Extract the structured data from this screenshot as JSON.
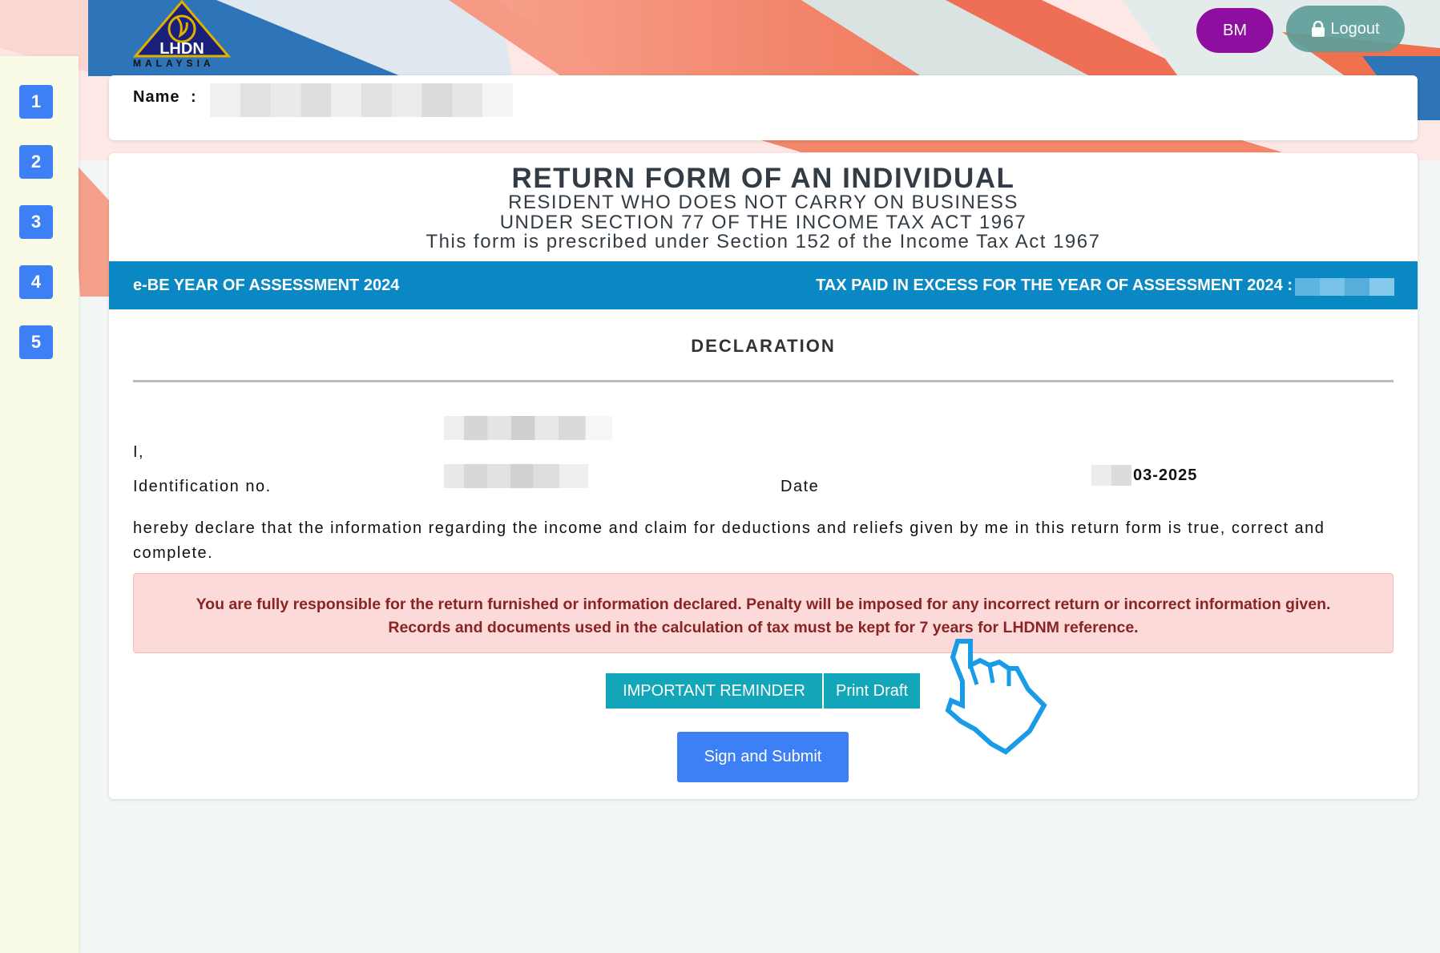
{
  "header": {
    "logo_text": "LHDN",
    "logo_subtext": "MALAYSIA",
    "bm_label": "BM",
    "logout_label": "Logout"
  },
  "sidebar": {
    "steps": [
      "1",
      "2",
      "3",
      "4",
      "5"
    ]
  },
  "name_card": {
    "label": "Name",
    "colon": ":"
  },
  "form": {
    "title": "RETURN FORM OF AN INDIVIDUAL",
    "subtitle_1": "RESIDENT WHO DOES NOT CARRY ON BUSINESS",
    "subtitle_2": "UNDER SECTION 77 OF THE INCOME TAX ACT 1967",
    "subtitle_3": "This form is prescribed under Section 152 of the Income Tax Act 1967",
    "bar_left": "e-BE YEAR OF ASSESSMENT 2024",
    "bar_right": "TAX PAID IN EXCESS FOR THE YEAR OF ASSESSMENT 2024 :"
  },
  "declaration": {
    "title": "DECLARATION",
    "i_label": "I,",
    "id_label": "Identification no.",
    "date_label": "Date",
    "date_value": "03-2025",
    "statement": "hereby declare that the information regarding the income and claim for deductions and reliefs given by me in this return form is true, correct and complete.",
    "alert_line_1": "You are fully responsible for the return furnished or information declared. Penalty will be imposed for any incorrect return or incorrect information given.",
    "alert_line_2": "Records and documents used in the calculation of tax must be kept for 7 years for LHDNM reference."
  },
  "actions": {
    "reminder_label": "IMPORTANT REMINDER",
    "print_label": "Print Draft",
    "submit_label": "Sign and Submit"
  },
  "colors": {
    "accent_blue": "#3d7ff5",
    "bar_blue": "#0a88c4",
    "teal": "#13a6b8",
    "bm_purple": "#8e0ea0",
    "logout_teal": "#5f9e9a",
    "alert_bg": "#fcdada",
    "alert_text": "#8a2323"
  }
}
